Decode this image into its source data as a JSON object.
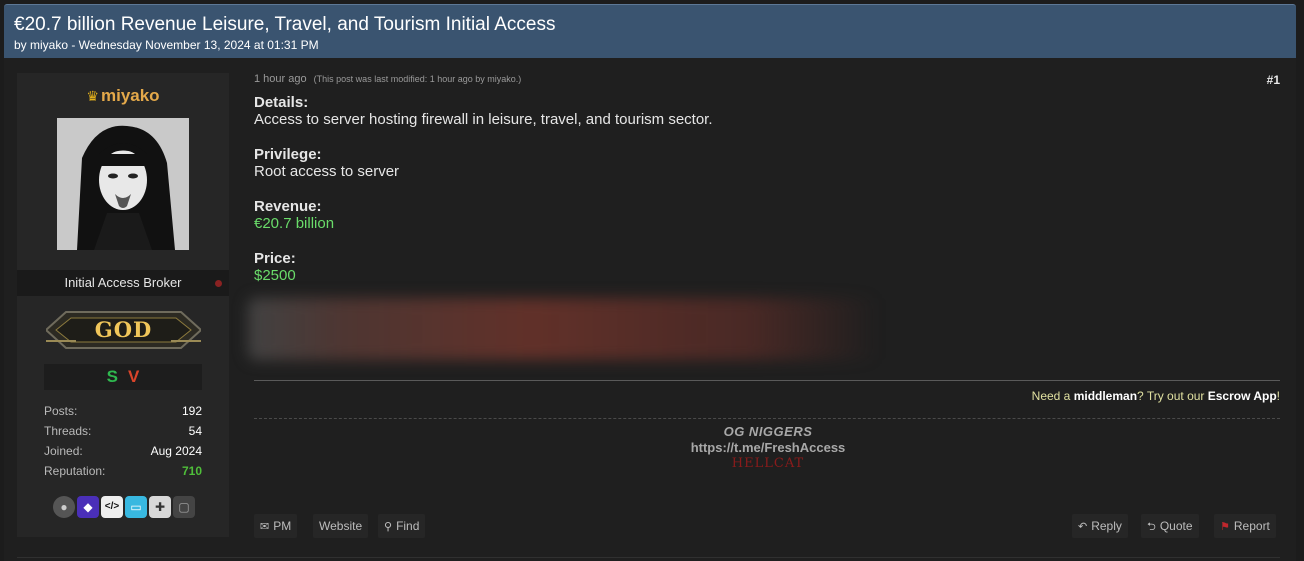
{
  "thread": {
    "title": "€20.7 billion Revenue Leisure, Travel, and Tourism Initial Access",
    "byline": "by miyako - Wednesday November 13, 2024 at 01:31 PM"
  },
  "profile": {
    "username": "miyako",
    "user_title": "Initial Access Broker",
    "rank": "GOD",
    "awards": [
      "S",
      "V"
    ],
    "stats": [
      {
        "label": "Posts:",
        "value": "192"
      },
      {
        "label": "Threads:",
        "value": "54"
      },
      {
        "label": "Joined:",
        "value": "Aug 2024"
      },
      {
        "label": "Reputation:",
        "value": "710"
      }
    ],
    "badge_icons": [
      "bomb-icon",
      "cube-icon",
      "code-icon",
      "monitor-icon",
      "gamepad-icon",
      "chat-icon"
    ]
  },
  "post": {
    "time": "1 hour ago",
    "modified": "(This post was last modified: 1 hour ago by miyako.)",
    "number": "#1",
    "fields": [
      {
        "label": "Details:",
        "value": "Access to server hosting firewall in leisure, travel, and tourism sector."
      },
      {
        "label": "Privilege:",
        "value": "Root access to server"
      },
      {
        "label": "Revenue:",
        "value": "€20.7 billion"
      },
      {
        "label": "Price:",
        "value": "$2500"
      }
    ],
    "escrow": {
      "prefix": "Need a ",
      "bold1": "middleman",
      "middle": "? Try out our ",
      "bold2": "Escrow App",
      "suffix": "!"
    },
    "signature": {
      "line1": "OG NIGGERS",
      "line2": "https://t.me/FreshAccess",
      "line3": "HELLCAT"
    }
  },
  "actions": {
    "pm": "PM",
    "website": "Website",
    "find": "Find",
    "reply": "Reply",
    "quote": "Quote",
    "report": "Report"
  },
  "colors": {
    "header_bg": "#3a5470",
    "green_value": "#6adc6a",
    "reputation": "#4fbf3a",
    "username": "#e4a94a"
  }
}
